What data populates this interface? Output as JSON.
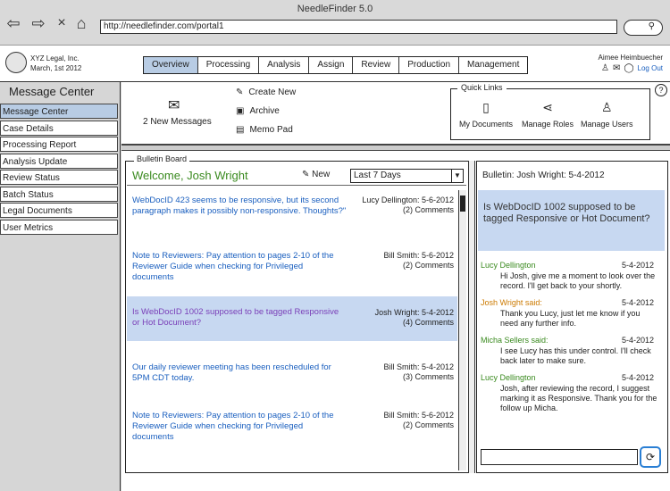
{
  "window": {
    "title": "NeedleFinder 5.0",
    "url": "http://needlefinder.com/portal1"
  },
  "header": {
    "company": "XYZ Legal, Inc.",
    "date": "March, 1st 2012",
    "user": "Aimee Heimbuecher",
    "logout": "Log Out",
    "nav": [
      "Overview",
      "Processing",
      "Analysis",
      "Assign",
      "Review",
      "Production",
      "Management"
    ],
    "active_nav": "Overview"
  },
  "sidebar": {
    "title": "Message Center",
    "items": [
      "Message Center",
      "Case Details",
      "Processing Report",
      "Analysis Update",
      "Review Status",
      "Batch Status",
      "Legal Documents",
      "User Metrics"
    ]
  },
  "actions": {
    "new_messages": "2 New Messages",
    "create": "Create New",
    "archive": "Archive",
    "memo": "Memo Pad"
  },
  "quick_links": {
    "title": "Quick Links",
    "items": [
      "My Documents",
      "Manage Roles",
      "Manage Users"
    ]
  },
  "bulletin": {
    "title": "Bulletin Board",
    "welcome": "Welcome, Josh Wright",
    "new_label": "New",
    "filter": "Last 7 Days",
    "posts": [
      {
        "text": "WebDocID 423 seems to be responsive, but its second paragraph makes it possibly non-responsive. Thoughts?\"",
        "author": "Lucy Dellington: 5-6-2012",
        "comments": "(2) Comments"
      },
      {
        "text": "Note to Reviewers: Pay attention to pages 2-10 of the Reviewer Guide when checking for Privileged documents",
        "author": "Bill Smith: 5-6-2012",
        "comments": "(2) Comments"
      },
      {
        "text": "Is WebDocID 1002 supposed to be tagged Responsive or Hot Document?",
        "author": "Josh Wright: 5-4-2012",
        "comments": "(4) Comments"
      },
      {
        "text": "Our daily reviewer meeting has been rescheduled for 5PM CDT today.",
        "author": "Bill Smith: 5-4-2012",
        "comments": "(3) Comments"
      },
      {
        "text": "Note to Reviewers: Pay attention to pages 2-10 of the Reviewer Guide when checking for Privileged documents",
        "author": "Bill Smith: 5-6-2012",
        "comments": "(2) Comments"
      }
    ]
  },
  "chat": {
    "title": "Bulletin: Josh Wright: 5-4-2012",
    "question": "Is WebDocID 1002 supposed to be tagged Responsive or Hot Document?",
    "messages": [
      {
        "who": "Lucy Dellington",
        "date": "5-4-2012",
        "body": "Hi Josh, give me a moment to look over the record. I'll get back to your shortly."
      },
      {
        "who": "Josh Wright said:",
        "date": "5-4-2012",
        "body": "Thank you Lucy, just let me know if you need any further info."
      },
      {
        "who": "Micha Sellers said:",
        "date": "5-4-2012",
        "body": "I see Lucy has this under control. I'll check back later to make sure."
      },
      {
        "who": "Lucy Dellington",
        "date": "5-4-2012",
        "body": "Josh, after reviewing the record, I suggest marking it as Responsive. Thank you for the follow up Micha."
      }
    ]
  }
}
